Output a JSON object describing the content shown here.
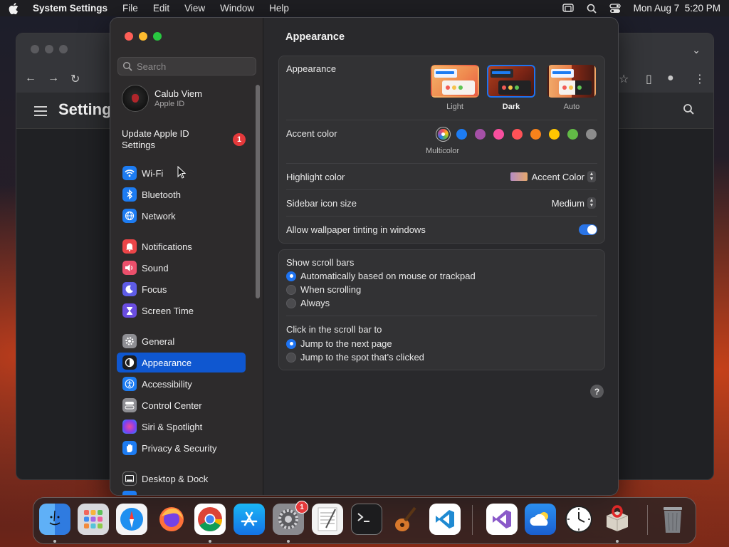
{
  "menubar": {
    "app_name": "System Settings",
    "menus": [
      "File",
      "Edit",
      "View",
      "Window",
      "Help"
    ],
    "datetime": "Mon Aug 7  5:20 PM"
  },
  "browser": {
    "page_title": "Setting"
  },
  "search": {
    "placeholder": "Search"
  },
  "profile": {
    "name": "Calub Viem",
    "subtitle": "Apple ID"
  },
  "update": {
    "label": "Update Apple ID Settings",
    "badge": "1"
  },
  "sidebar": {
    "items": [
      {
        "label": "Wi-Fi",
        "icon": "wifi-icon",
        "color": "#1d7cf2"
      },
      {
        "label": "Bluetooth",
        "icon": "bluetooth-icon",
        "color": "#1d7cf2"
      },
      {
        "label": "Network",
        "icon": "globe-icon",
        "color": "#1d7cf2"
      },
      {
        "label": "Notifications",
        "icon": "bell-icon",
        "color": "#eb4548"
      },
      {
        "label": "Sound",
        "icon": "speaker-icon",
        "color": "#eb4f6b"
      },
      {
        "label": "Focus",
        "icon": "moon-icon",
        "color": "#5e5ce6"
      },
      {
        "label": "Screen Time",
        "icon": "hourglass-icon",
        "color": "#6a4de0"
      },
      {
        "label": "General",
        "icon": "gear-icon",
        "color": "#8e8e93"
      },
      {
        "label": "Appearance",
        "icon": "appearance-icon",
        "color": "#1c1c1e"
      },
      {
        "label": "Accessibility",
        "icon": "accessibility-icon",
        "color": "#1d7cf2"
      },
      {
        "label": "Control Center",
        "icon": "toggles-icon",
        "color": "#8e8e93"
      },
      {
        "label": "Siri & Spotlight",
        "icon": "siri-icon",
        "color": "#7b3ff2"
      },
      {
        "label": "Privacy & Security",
        "icon": "hand-icon",
        "color": "#1d7cf2"
      },
      {
        "label": "Desktop & Dock",
        "icon": "dock-icon",
        "color": "#2c2c2e"
      }
    ],
    "active": "Appearance"
  },
  "content": {
    "title": "Appearance",
    "appearance_label": "Appearance",
    "themes": [
      {
        "label": "Light",
        "selected": false
      },
      {
        "label": "Dark",
        "selected": true
      },
      {
        "label": "Auto",
        "selected": false
      }
    ],
    "accent_label": "Accent color",
    "accent_colors": [
      "multicolor",
      "#1d7cf2",
      "#a550a7",
      "#f74f9e",
      "#ff5257",
      "#f7821b",
      "#ffc600",
      "#62ba46",
      "#8c8c8c"
    ],
    "accent_selected_name": "Multicolor",
    "highlight_label": "Highlight color",
    "highlight_value": "Accent Color",
    "sidebar_icon_label": "Sidebar icon size",
    "sidebar_icon_value": "Medium",
    "wallpaper_tint_label": "Allow wallpaper tinting in windows",
    "wallpaper_tint_on": true,
    "scrollbars_title": "Show scroll bars",
    "scrollbar_options": [
      {
        "label": "Automatically based on mouse or trackpad",
        "selected": true
      },
      {
        "label": "When scrolling",
        "selected": false
      },
      {
        "label": "Always",
        "selected": false
      }
    ],
    "click_title": "Click in the scroll bar to",
    "click_options": [
      {
        "label": "Jump to the next page",
        "selected": true
      },
      {
        "label": "Jump to the spot that’s clicked",
        "selected": false
      }
    ],
    "help": "?"
  },
  "dock": {
    "apps": [
      "Finder",
      "Launchpad",
      "Safari",
      "Firefox",
      "Chrome",
      "App Store",
      "System Settings",
      "TextEdit",
      "Terminal",
      "GarageBand",
      "VS Code",
      "Visual Studio",
      "Weather",
      "Clock",
      "Package",
      "Trash"
    ],
    "settings_badge": "1"
  }
}
